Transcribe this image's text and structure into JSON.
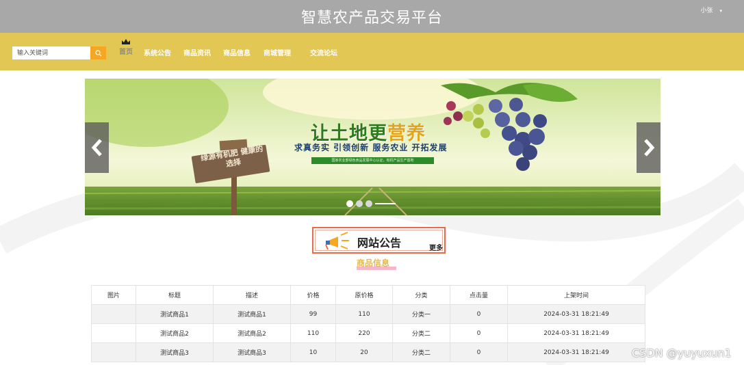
{
  "header": {
    "title": "智慧农产品交易平台",
    "user": "小张",
    "user_caret": "▾"
  },
  "search": {
    "placeholder": "输入关键词"
  },
  "nav": {
    "home": "首页",
    "items": [
      "系统公告",
      "商品资讯",
      "商品信息",
      "商城管理 ",
      "交流论坛"
    ]
  },
  "banner": {
    "headline_a": "让土地更",
    "headline_b": "营养",
    "subline": "求真务实  引领创新  服务农业  开拓发展",
    "strip": "国家农业部绿色食品发展中心认证，有机产品生产基地",
    "sign": "绿源有机肥 健康的选择",
    "slide_count": 3,
    "active_slide": 1
  },
  "notice": {
    "title": "网站公告",
    "more": "更多"
  },
  "products": {
    "section_title": "商品信息",
    "columns": [
      "图片",
      "标题",
      "描述",
      "价格",
      "原价格",
      "分类",
      "点击量",
      "上架时间"
    ],
    "rows": [
      [
        "",
        "测试商品1",
        "测试商品1",
        "99",
        "110",
        "分类一",
        "0",
        "2024-03-31 18:21:49"
      ],
      [
        "",
        "测试商品2",
        "测试商品2",
        "110",
        "220",
        "分类二",
        "0",
        "2024-03-31 18:21:49"
      ],
      [
        "",
        "测试商品3",
        "测试商品3",
        "10",
        "20",
        "分类二",
        "0",
        "2024-03-31 18:21:49"
      ]
    ]
  },
  "watermark": "CSDN @yuyuxun1",
  "colors": {
    "topbar": "#a8a8a8",
    "navbar": "#e3c755",
    "search_button": "#f5a623",
    "notice_border": "#e86a4a",
    "section_title": "#e8b84a"
  }
}
